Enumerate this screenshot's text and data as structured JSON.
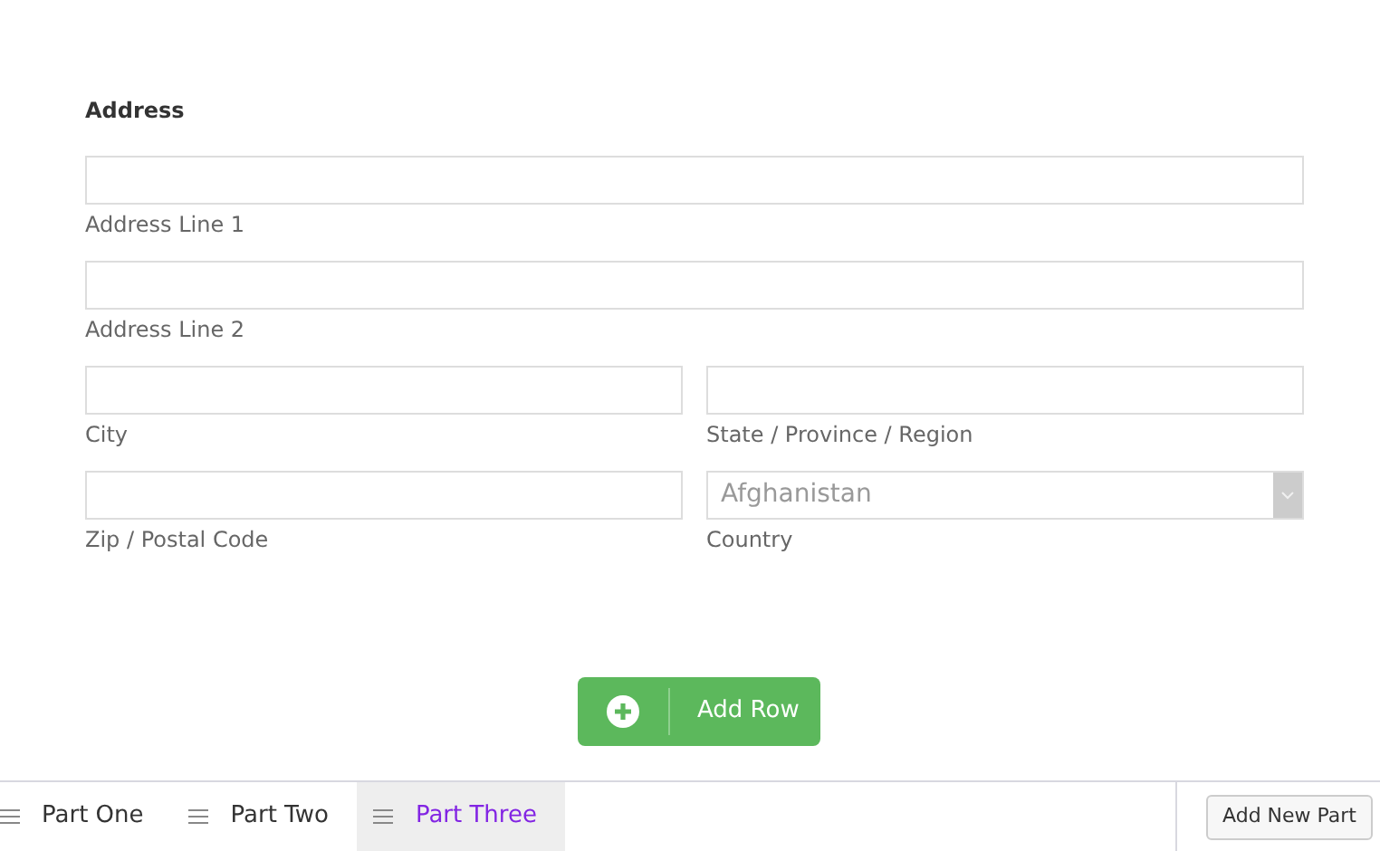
{
  "section_title": "Address",
  "rows": [
    {
      "fields": [
        {
          "kind": "text",
          "label": "Address Line 1"
        }
      ]
    },
    {
      "fields": [
        {
          "kind": "text",
          "label": "Address Line 2"
        }
      ]
    },
    {
      "fields": [
        {
          "kind": "text",
          "label": "City"
        },
        {
          "kind": "text",
          "label": "State / Province / Region"
        }
      ]
    },
    {
      "fields": [
        {
          "kind": "text",
          "label": "Zip / Postal Code"
        },
        {
          "kind": "select",
          "value": "Afghanistan",
          "label": "Country"
        }
      ]
    }
  ],
  "add_row_button": "Add Row",
  "tabs": [
    {
      "label": "Part One",
      "selected": false
    },
    {
      "label": "Part Two",
      "selected": false
    },
    {
      "label": "Part Three",
      "selected": true
    }
  ],
  "add_part_button": "Add New Part"
}
